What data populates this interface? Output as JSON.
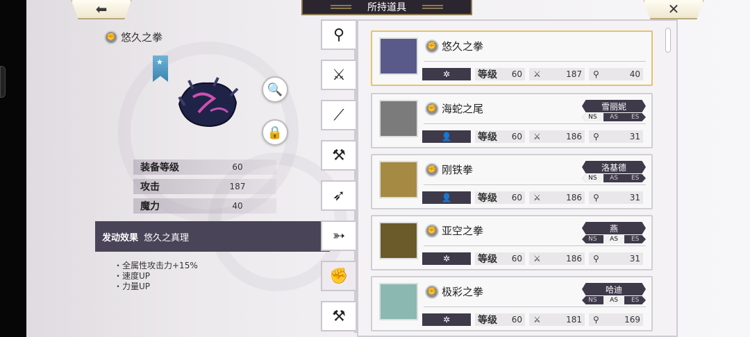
{
  "header": {
    "title": "所持道具",
    "back_icon": "back-arrow-icon",
    "close_icon": "close-icon"
  },
  "detail": {
    "name": "悠久之拳",
    "stats": [
      {
        "label": "装备等级",
        "value": "60"
      },
      {
        "label": "攻击",
        "value": "187"
      },
      {
        "label": "魔力",
        "value": "40"
      }
    ],
    "effect_header": "发动效果",
    "effect_name": "悠久之真理",
    "effects": [
      "・全属性攻击力+15%",
      "・速度UP",
      "・力量UP"
    ]
  },
  "tabs": [
    {
      "icon": "staff-icon",
      "glyph": "⚲"
    },
    {
      "icon": "sword-icon",
      "glyph": "⚔"
    },
    {
      "icon": "katana-icon",
      "glyph": "⟋"
    },
    {
      "icon": "axe-icon",
      "glyph": "⚒"
    },
    {
      "icon": "spear-icon",
      "glyph": "➶"
    },
    {
      "icon": "bow-icon",
      "glyph": "➳"
    },
    {
      "icon": "fist-icon",
      "glyph": "✊"
    },
    {
      "icon": "hammer-icon",
      "glyph": "⚒"
    }
  ],
  "labels": {
    "level": "等级"
  },
  "items": [
    {
      "name": "悠久之拳",
      "equip": "✲",
      "level": "60",
      "atk": "187",
      "mag": "40",
      "character": "",
      "types": [],
      "thumb_color": "#5a5a8a"
    },
    {
      "name": "海蛇之尾",
      "equip": "👤",
      "level": "60",
      "atk": "186",
      "mag": "31",
      "character": "雪丽妮",
      "types": [
        "NS",
        "AS",
        "ES"
      ],
      "active_type": "NS",
      "thumb_color": "#7b7b7b"
    },
    {
      "name": "刚铁拳",
      "equip": "👤",
      "level": "60",
      "atk": "186",
      "mag": "31",
      "character": "洛基德",
      "types": [
        "NS",
        "AS",
        "ES"
      ],
      "active_type": "NS",
      "thumb_color": "#a58a43"
    },
    {
      "name": "亚空之拳",
      "equip": "✲",
      "level": "60",
      "atk": "186",
      "mag": "31",
      "character": "燕",
      "types": [
        "NS",
        "AS",
        "ES"
      ],
      "active_type": "AS",
      "thumb_color": "#6b5a2a"
    },
    {
      "name": "极彩之拳",
      "equip": "✲",
      "level": "60",
      "atk": "181",
      "mag": "169",
      "character": "哈迪",
      "types": [
        "NS",
        "AS",
        "ES"
      ],
      "active_type": "AS",
      "thumb_color": "#8bb8b0"
    }
  ],
  "colors": {
    "panel_dark": "#3f3a4a",
    "selected_border": "#e3c36c"
  }
}
